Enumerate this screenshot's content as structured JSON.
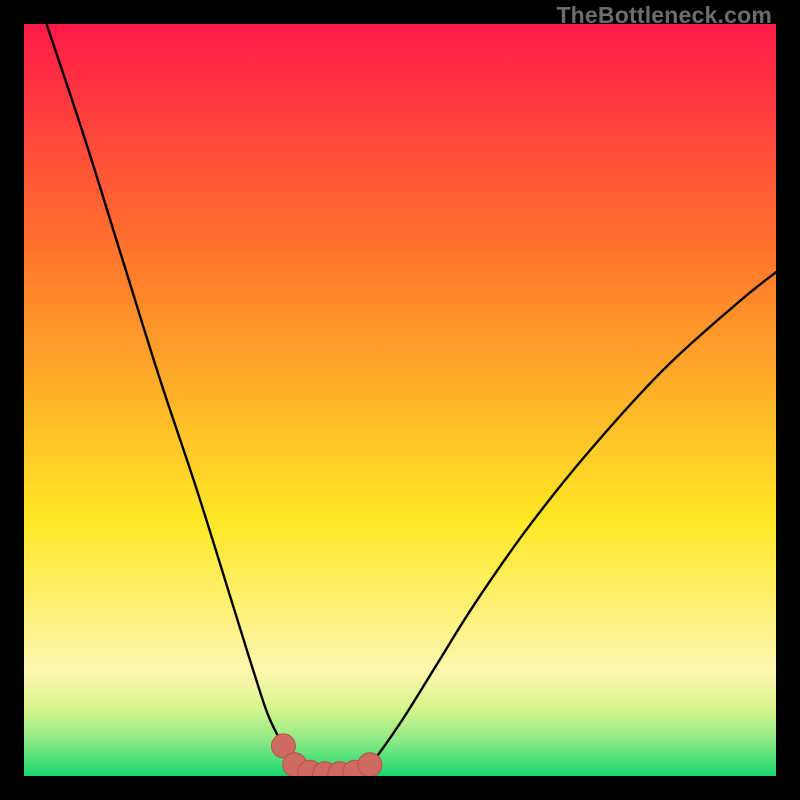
{
  "watermark": "TheBottleneck.com",
  "colors": {
    "black": "#000000",
    "curve": "#000000",
    "marker_fill": "#cf6a60",
    "marker_stroke": "#b45047",
    "gradient_top": "#ff1a49",
    "gradient_upper": "#ff7a2b",
    "gradient_mid": "#ffe825",
    "gradient_lower_a": "#fdf7b0",
    "gradient_lower_b": "#d7f58b",
    "gradient_lower_c": "#93eb88",
    "gradient_bottom": "#18d66c"
  },
  "chart_data": {
    "type": "line",
    "title": "",
    "xlabel": "",
    "ylabel": "",
    "xlim": [
      0,
      100
    ],
    "ylim": [
      0,
      100
    ],
    "grid": false,
    "legend": false,
    "annotations": [
      "TheBottleneck.com"
    ],
    "series": [
      {
        "name": "bottleneck-curve",
        "x": [
          3,
          8,
          13,
          18,
          23,
          28,
          30.5,
          32.5,
          34.5,
          36,
          38,
          40,
          42,
          44,
          46,
          50,
          55,
          60,
          67,
          75,
          85,
          95,
          100
        ],
        "y": [
          100,
          85,
          69,
          53,
          38,
          22,
          14,
          8,
          4,
          1.5,
          0.5,
          0.3,
          0.3,
          0.5,
          1.5,
          7,
          15,
          23,
          33,
          43,
          54,
          63,
          67
        ]
      }
    ],
    "markers": {
      "name": "highlight-points",
      "x": [
        34.5,
        36,
        38,
        40,
        42,
        44,
        46
      ],
      "y": [
        4.0,
        1.5,
        0.5,
        0.3,
        0.3,
        0.5,
        1.5
      ]
    },
    "background": {
      "type": "vertical-gradient",
      "description": "Red at top grading through orange, yellow, pale yellow, pale green, to green at bottom; indicates bottleneck severity from high (top) to none (bottom)."
    }
  }
}
